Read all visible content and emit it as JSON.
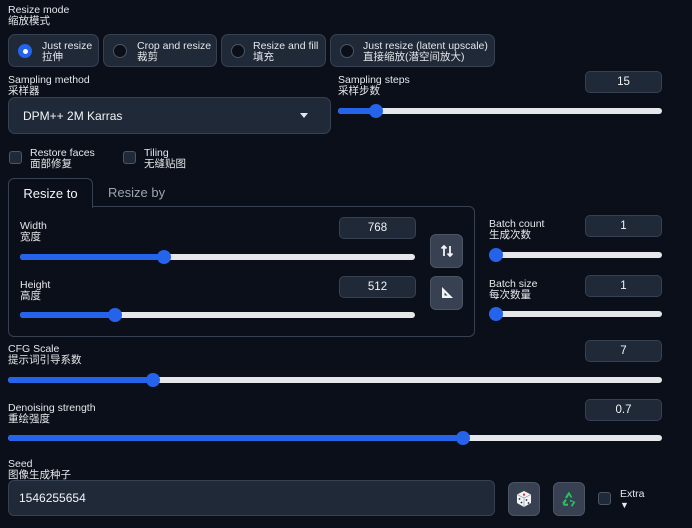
{
  "resize_mode": {
    "label_en": "Resize mode",
    "label_zh": "缩放模式",
    "options": [
      {
        "en": "Just resize",
        "zh": "拉伸",
        "selected": true
      },
      {
        "en": "Crop and resize",
        "zh": "裁剪",
        "selected": false
      },
      {
        "en": "Resize and fill",
        "zh": "填充",
        "selected": false
      },
      {
        "en": "Just resize (latent upscale)",
        "zh": "直接缩放(潜空间放大)",
        "selected": false
      }
    ]
  },
  "sampling_method": {
    "label_en": "Sampling method",
    "label_zh": "采样器",
    "value": "DPM++ 2M Karras"
  },
  "sampling_steps": {
    "label_en": "Sampling steps",
    "label_zh": "采样步数",
    "value": "15",
    "fraction": 0.1
  },
  "restore_faces": {
    "en": "Restore faces",
    "zh": "面部修复",
    "checked": false
  },
  "tiling": {
    "en": "Tiling",
    "zh": "无缝贴图",
    "checked": false
  },
  "tabs": {
    "resize_to": "Resize to",
    "resize_by": "Resize by"
  },
  "width": {
    "label_en": "Width",
    "label_zh": "宽度",
    "value": "768",
    "fraction": 0.36
  },
  "height": {
    "label_en": "Height",
    "label_zh": "高度",
    "value": "512",
    "fraction": 0.23
  },
  "batch_count": {
    "label_en": "Batch count",
    "label_zh": "生成次数",
    "value": "1",
    "fraction": 0.0
  },
  "batch_size": {
    "label_en": "Batch size",
    "label_zh": "每次数量",
    "value": "1",
    "fraction": 0.0
  },
  "cfg_scale": {
    "label_en": "CFG Scale",
    "label_zh": "提示词引导系数",
    "value": "7",
    "fraction": 0.215
  },
  "denoising": {
    "label_en": "Denoising strength",
    "label_zh": "重绘强度",
    "value": "0.7",
    "fraction": 0.7
  },
  "seed": {
    "label_en": "Seed",
    "label_zh": "图像生成种子",
    "value": "1546255654"
  },
  "extra": {
    "label": "Extra",
    "arrow": "▼",
    "checked": false
  },
  "icons": {
    "swap": "swap-dimensions-icon",
    "aspect": "aspect-ratio-icon",
    "dice": "dice-icon",
    "recycle": "recycle-icon",
    "dropdown": "caret-down-icon"
  },
  "colors": {
    "background": "#0b0f19",
    "panel": "#1f2937",
    "border": "#374151",
    "accent": "#2563eb",
    "recycle": "#22c55e"
  }
}
